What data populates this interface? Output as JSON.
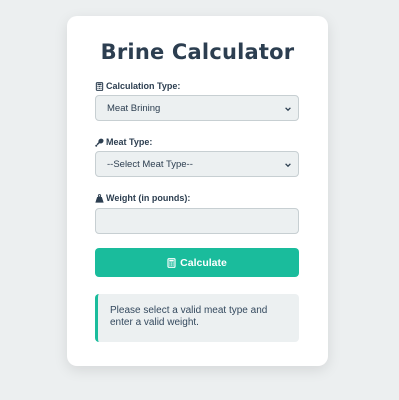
{
  "app": {
    "title": "Brine Calculator"
  },
  "form": {
    "calculation_type": {
      "label": "Calculation Type:",
      "icon": "calculator-icon",
      "selected": "Meat Brining"
    },
    "meat_type": {
      "label": "Meat Type:",
      "icon": "drumstick-icon",
      "selected": "--Select Meat Type--"
    },
    "weight": {
      "label": "Weight (in pounds):",
      "icon": "weight-icon",
      "value": ""
    },
    "calculate_button": {
      "label": "Calculate",
      "icon": "calculator-icon"
    }
  },
  "message": {
    "text": "Please select a valid meat type and enter a valid weight."
  },
  "colors": {
    "accent": "#1abc9c",
    "text": "#2c3e50",
    "field_bg": "#ecf0f1",
    "page_bg": "#eceff0"
  }
}
